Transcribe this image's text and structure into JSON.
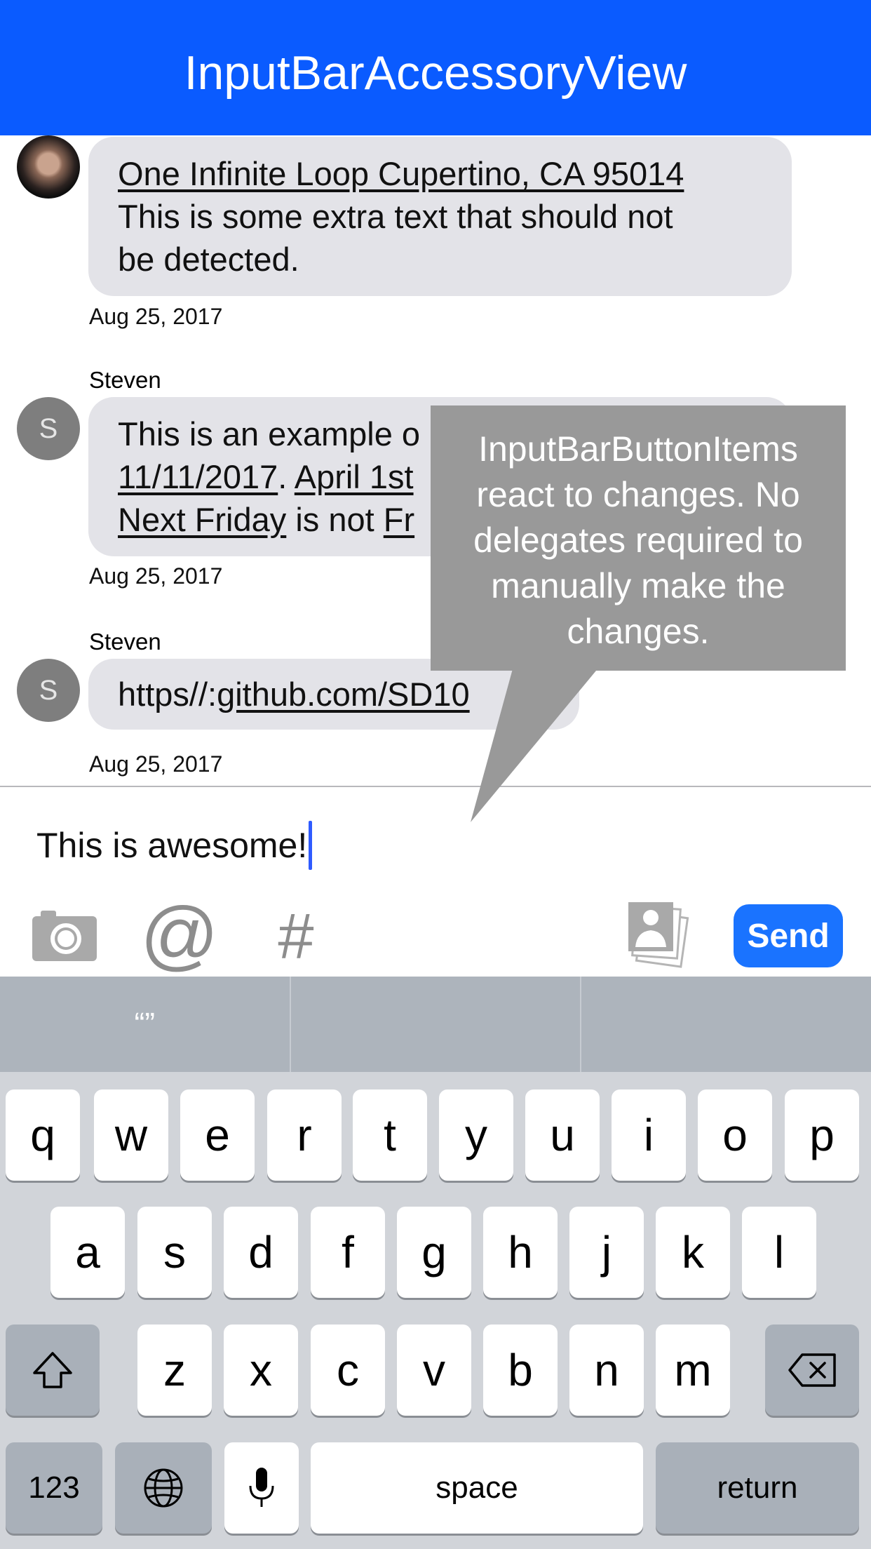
{
  "header": {
    "title": "InputBarAccessoryView",
    "background": "#0a5bff"
  },
  "messages": [
    {
      "avatar": "photo",
      "lines": [
        [
          {
            "text": "One Infinite Loop Cupertino, CA 95014",
            "link": true
          }
        ],
        [
          {
            "text": "This is some extra text that should not",
            "link": false
          }
        ],
        [
          {
            "text": "be detected.",
            "link": false
          }
        ]
      ],
      "date": "Aug 25, 2017"
    },
    {
      "sender": "Steven",
      "avatar_initial": "S",
      "lines": [
        [
          {
            "text": "This is an example o",
            "link": false
          }
        ],
        [
          {
            "text": "11/11/2017",
            "link": true
          },
          {
            "text": ". ",
            "link": false
          },
          {
            "text": "April 1st",
            "link": true
          }
        ],
        [
          {
            "text": "Next Friday",
            "link": true
          },
          {
            "text": " is not ",
            "link": false
          },
          {
            "text": "Fr",
            "link": true
          }
        ]
      ],
      "date": "Aug 25, 2017"
    },
    {
      "sender": "Steven",
      "avatar_initial": "S",
      "lines": [
        [
          {
            "text": "https//:",
            "link": false
          },
          {
            "text": "github.com/SD10",
            "link": true
          }
        ]
      ],
      "date": "Aug 25, 2017"
    }
  ],
  "tooltip": {
    "text": "InputBarButtonItems react to changes. No delegates required to manually make the changes.",
    "lines": [
      "InputBarButtonItems",
      "react to changes. No",
      "delegates required to",
      "manually make the",
      "changes."
    ]
  },
  "input": {
    "value": "This is awesome!"
  },
  "toolbar": {
    "icons": [
      "camera-icon",
      "at-sign-icon",
      "hashtag-icon",
      "photos-icon"
    ],
    "at_label": "@",
    "hash_label": "#",
    "send_label": "Send",
    "send_color": "#1a73ff"
  },
  "keyboard": {
    "predictive": [
      "“”",
      "",
      ""
    ],
    "row1": [
      "q",
      "w",
      "e",
      "r",
      "t",
      "y",
      "u",
      "i",
      "o",
      "p"
    ],
    "row2": [
      "a",
      "s",
      "d",
      "f",
      "g",
      "h",
      "j",
      "k",
      "l"
    ],
    "row3": [
      "z",
      "x",
      "c",
      "v",
      "b",
      "n",
      "m"
    ],
    "numbers_label": "123",
    "space_label": "space",
    "return_label": "return"
  }
}
